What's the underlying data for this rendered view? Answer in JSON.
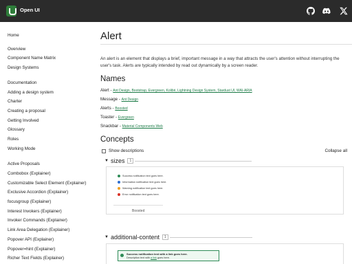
{
  "header": {
    "brand": "Open UI",
    "icons": [
      "github-icon",
      "discord-icon",
      "x-twitter-icon"
    ],
    "colors": {
      "bar": "#2b2b2b",
      "logo": "#2e7d3a"
    }
  },
  "sidebar": {
    "items": [
      "Home",
      "Overview",
      "Component Name Matrix",
      "Design Systems",
      "Documentation",
      "Adding a design system",
      "Charter",
      "Creating a proposal",
      "Getting Involved",
      "Glossary",
      "Roles",
      "Working Mode",
      "Active Proposals",
      "Combobox (Explainer)",
      "Customizable Select Element (Explainer)",
      "Exclusive Accordion (Explainer)",
      "focusgroup (Explainer)",
      "Interest Invokers (Explainer)",
      "Invoker Commands (Explainer)",
      "Link Area Delegation (Explainer)",
      "Popover API (Explainer)",
      "Popover=hint (Explainer)",
      "Richer Text Fields (Explainer)"
    ]
  },
  "main": {
    "title": "Alert",
    "intro": "An alert is an element that displays a brief, important message in a way that attracts the user's attention without interrupting the user's task. Alerts are typically intended by read out dynamically by a screen reader.",
    "names_heading": "Names",
    "names": [
      {
        "label": "Alert - ",
        "systems": "Ant Design, Bootstrap, Evergreen, Kolibri, Lightning Design System, Stardust UI, WAI-ARIA"
      },
      {
        "label": "Message - ",
        "systems": "Ant Design"
      },
      {
        "label": "Alerts - ",
        "systems": "Boosted"
      },
      {
        "label": "Toaster - ",
        "systems": "Evergreen"
      },
      {
        "label": "Snackbar - ",
        "systems": "Material Components Web"
      }
    ],
    "concepts_heading": "Concepts",
    "show_descriptions": "Show descriptions",
    "collapse_all": "Collapse all",
    "concepts": [
      {
        "name": "sizes",
        "count": "1",
        "alerts": [
          {
            "text": "Success notification text goes here.",
            "color": "#2e8b57"
          },
          {
            "text": "Information notification text goes here.",
            "color": "#2f6fd1"
          },
          {
            "text": "Warning notification text goes here.",
            "color": "#f0a020"
          },
          {
            "text": "Error notification text goes here.",
            "color": "#d93025"
          }
        ],
        "caption": "Boosted"
      },
      {
        "name": "additional-content",
        "count": "1",
        "success_title": "Success notification text with a link goes here.",
        "success_desc_pre": "Description text with ",
        "success_desc_link": "a link",
        "success_desc_post": " goes here."
      }
    ]
  }
}
